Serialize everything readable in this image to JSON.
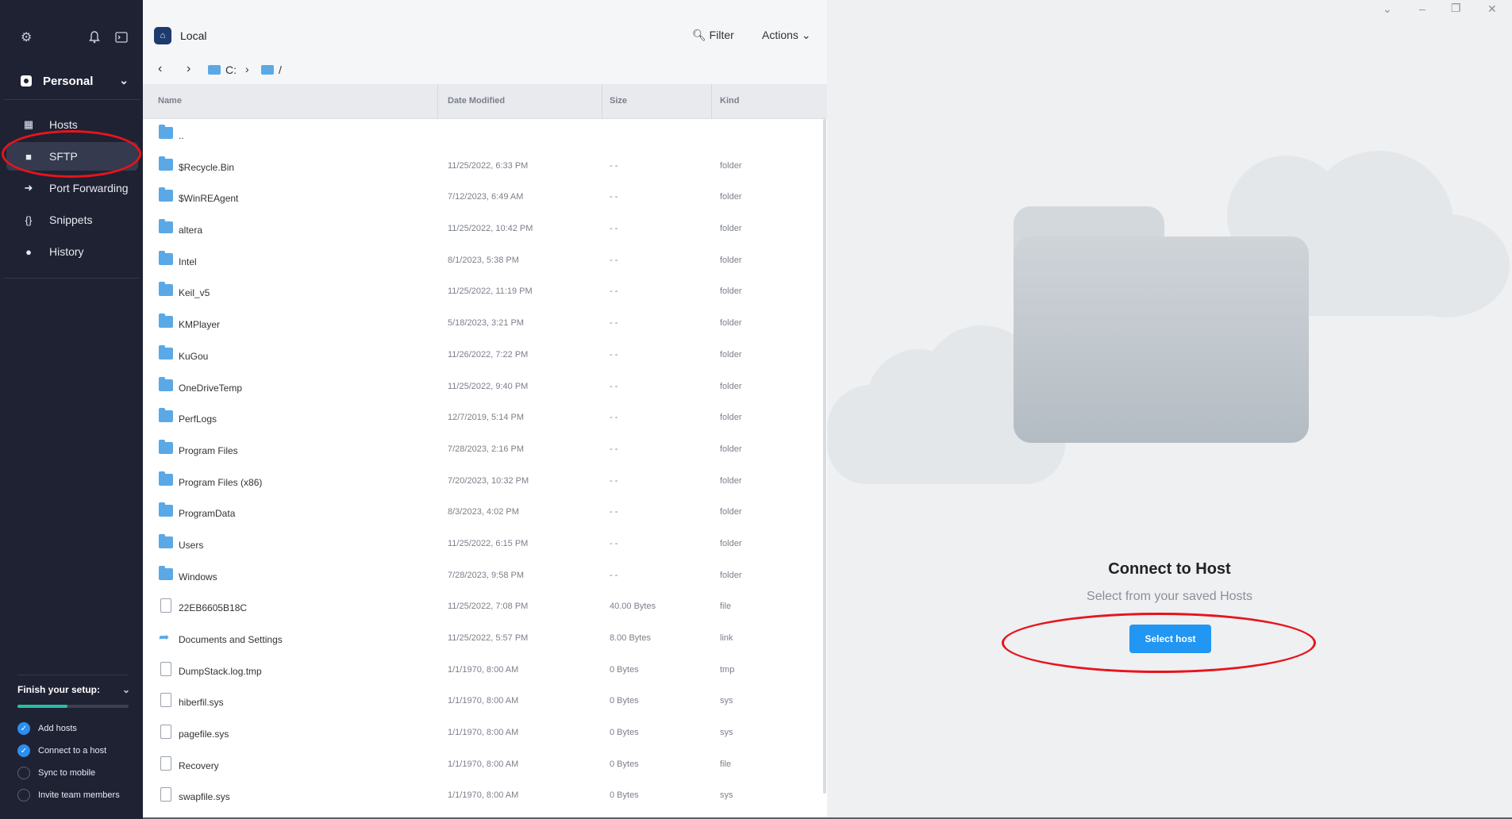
{
  "sidebar": {
    "icons": {
      "settings": "gear-icon",
      "notifications": "bell-icon",
      "terminal": "terminal-icon"
    },
    "workspace": "Personal",
    "nav": [
      {
        "label": "Hosts",
        "icon": "grid-icon"
      },
      {
        "label": "SFTP",
        "icon": "folder-icon",
        "active": true
      },
      {
        "label": "Port Forwarding",
        "icon": "arrow-icon"
      },
      {
        "label": "Snippets",
        "icon": "braces-icon"
      },
      {
        "label": "History",
        "icon": "clock-icon"
      }
    ],
    "setup": {
      "title": "Finish your setup:",
      "progress": 0.45,
      "items": [
        {
          "label": "Add hosts",
          "done": true
        },
        {
          "label": "Connect to a host",
          "done": true
        },
        {
          "label": "Sync to mobile",
          "done": false
        },
        {
          "label": "Invite team members",
          "done": false
        }
      ]
    }
  },
  "filepane": {
    "location": "Local",
    "filter_label": "Filter",
    "actions_label": "Actions",
    "breadcrumb": [
      "C:",
      "/"
    ],
    "columns": {
      "name": "Name",
      "date": "Date Modified",
      "size": "Size",
      "kind": "Kind"
    },
    "rows": [
      {
        "name": "..",
        "date": "",
        "size": "",
        "kind": "",
        "type": "folder"
      },
      {
        "name": "$Recycle.Bin",
        "date": "11/25/2022, 6:33 PM",
        "size": "- -",
        "kind": "folder",
        "type": "folder"
      },
      {
        "name": "$WinREAgent",
        "date": "7/12/2023, 6:49 AM",
        "size": "- -",
        "kind": "folder",
        "type": "folder"
      },
      {
        "name": "altera",
        "date": "11/25/2022, 10:42 PM",
        "size": "- -",
        "kind": "folder",
        "type": "folder"
      },
      {
        "name": "Intel",
        "date": "8/1/2023, 5:38 PM",
        "size": "- -",
        "kind": "folder",
        "type": "folder"
      },
      {
        "name": "Keil_v5",
        "date": "11/25/2022, 11:19 PM",
        "size": "- -",
        "kind": "folder",
        "type": "folder"
      },
      {
        "name": "KMPlayer",
        "date": "5/18/2023, 3:21 PM",
        "size": "- -",
        "kind": "folder",
        "type": "folder"
      },
      {
        "name": "KuGou",
        "date": "11/26/2022, 7:22 PM",
        "size": "- -",
        "kind": "folder",
        "type": "folder"
      },
      {
        "name": "OneDriveTemp",
        "date": "11/25/2022, 9:40 PM",
        "size": "- -",
        "kind": "folder",
        "type": "folder"
      },
      {
        "name": "PerfLogs",
        "date": "12/7/2019, 5:14 PM",
        "size": "- -",
        "kind": "folder",
        "type": "folder"
      },
      {
        "name": "Program Files",
        "date": "7/28/2023, 2:16 PM",
        "size": "- -",
        "kind": "folder",
        "type": "folder"
      },
      {
        "name": "Program Files (x86)",
        "date": "7/20/2023, 10:32 PM",
        "size": "- -",
        "kind": "folder",
        "type": "folder"
      },
      {
        "name": "ProgramData",
        "date": "8/3/2023, 4:02 PM",
        "size": "- -",
        "kind": "folder",
        "type": "folder"
      },
      {
        "name": "Users",
        "date": "11/25/2022, 6:15 PM",
        "size": "- -",
        "kind": "folder",
        "type": "folder"
      },
      {
        "name": "Windows",
        "date": "7/28/2023, 9:58 PM",
        "size": "- -",
        "kind": "folder",
        "type": "folder"
      },
      {
        "name": "22EB6605B18C",
        "date": "11/25/2022, 7:08 PM",
        "size": "40.00 Bytes",
        "kind": "file",
        "type": "file"
      },
      {
        "name": "Documents and Settings",
        "date": "11/25/2022, 5:57 PM",
        "size": "8.00 Bytes",
        "kind": "link",
        "type": "link"
      },
      {
        "name": "DumpStack.log.tmp",
        "date": "1/1/1970, 8:00 AM",
        "size": "0 Bytes",
        "kind": "tmp",
        "type": "file"
      },
      {
        "name": "hiberfil.sys",
        "date": "1/1/1970, 8:00 AM",
        "size": "0 Bytes",
        "kind": "sys",
        "type": "file"
      },
      {
        "name": "pagefile.sys",
        "date": "1/1/1970, 8:00 AM",
        "size": "0 Bytes",
        "kind": "sys",
        "type": "file"
      },
      {
        "name": "Recovery",
        "date": "1/1/1970, 8:00 AM",
        "size": "0 Bytes",
        "kind": "file",
        "type": "file"
      },
      {
        "name": "swapfile.sys",
        "date": "1/1/1970, 8:00 AM",
        "size": "0 Bytes",
        "kind": "sys",
        "type": "file"
      }
    ]
  },
  "rightpane": {
    "title": "Connect to Host",
    "subtitle": "Select from your saved Hosts",
    "button": "Select host"
  },
  "colors": {
    "accent": "#2196f3",
    "sidebar": "#1f2233",
    "folder": "#5aa9e6",
    "annotation": "#e8141c"
  }
}
